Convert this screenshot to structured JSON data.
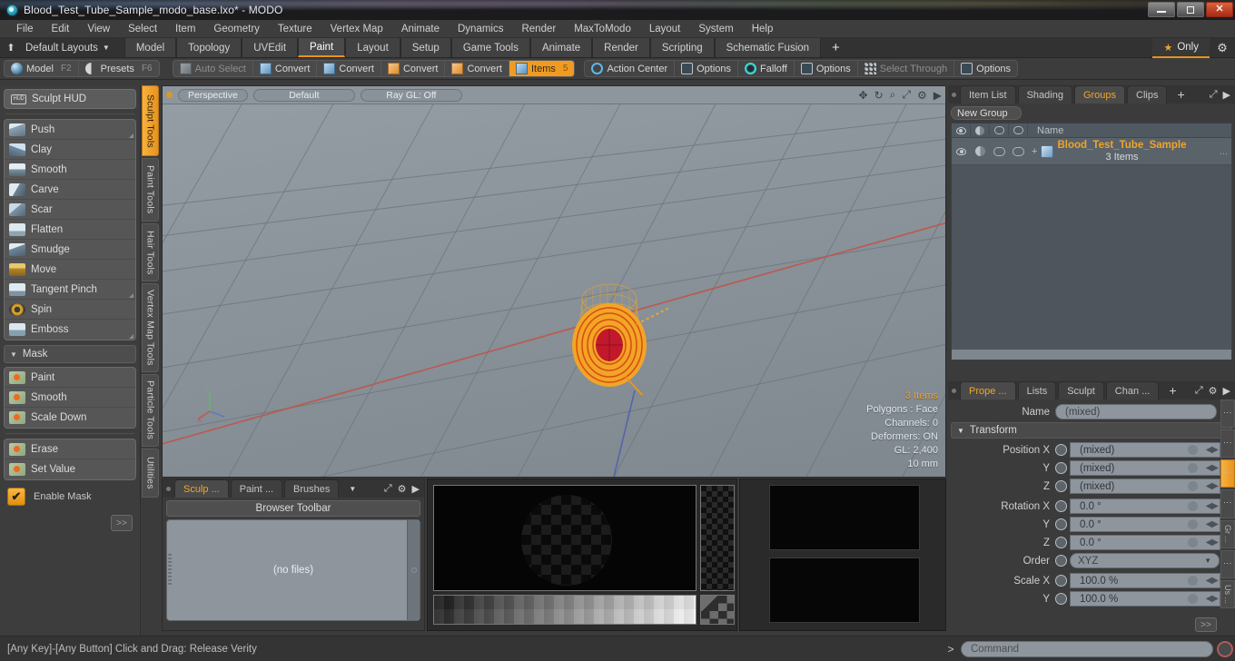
{
  "window": {
    "title": "Blood_Test_Tube_Sample_modo_base.lxo* - MODO",
    "app_icon": "modo-logo-icon",
    "minimize": "minimize-icon",
    "maximize": "restore-icon",
    "close": "close-icon"
  },
  "menubar": {
    "items": [
      "File",
      "Edit",
      "View",
      "Select",
      "Item",
      "Geometry",
      "Texture",
      "Vertex Map",
      "Animate",
      "Dynamics",
      "Render",
      "MaxToModo",
      "Layout",
      "System",
      "Help"
    ]
  },
  "layoutbar": {
    "home_icon": "home-up-icon",
    "layouts_label": "Default Layouts",
    "tabs": [
      {
        "label": "Model",
        "active": false
      },
      {
        "label": "Topology",
        "active": false
      },
      {
        "label": "UVEdit",
        "active": false
      },
      {
        "label": "Paint",
        "active": true
      },
      {
        "label": "Layout",
        "active": false
      },
      {
        "label": "Setup",
        "active": false
      },
      {
        "label": "Game Tools",
        "active": false
      },
      {
        "label": "Animate",
        "active": false
      },
      {
        "label": "Render",
        "active": false
      },
      {
        "label": "Scripting",
        "active": false
      },
      {
        "label": "Schematic Fusion",
        "active": false
      }
    ],
    "add_tab": "+",
    "only_label": "Only",
    "only_icon": "star-icon",
    "settings_icon": "gear-icon"
  },
  "modebar": {
    "left_group": [
      {
        "label": "Model",
        "hotkey": "F2",
        "icon": "sphere-icon",
        "active": false
      },
      {
        "label": "Presets",
        "hotkey": "F6",
        "icon": "half-sphere-icon",
        "active": false
      }
    ],
    "right_group": [
      {
        "label": "Auto Select",
        "icon": "cube-gray-icon",
        "active": false,
        "dim": true
      },
      {
        "label": "Convert",
        "icon": "cube-blue-icon",
        "active": false,
        "dim": false
      },
      {
        "label": "Convert",
        "icon": "cube-blue-icon",
        "active": false,
        "dim": false
      },
      {
        "label": "Convert",
        "icon": "cube-orange-icon",
        "active": false,
        "dim": false
      },
      {
        "label": "Convert",
        "icon": "cube-orange-icon",
        "active": false,
        "dim": false
      },
      {
        "label": "Items",
        "hotkey": "5",
        "icon": "cube-blue-icon",
        "active": true,
        "dim": false
      }
    ],
    "far_group": [
      {
        "label": "Action Center",
        "icon": "target-icon",
        "dim": false
      },
      {
        "label": "Options",
        "icon": "box-icon",
        "dim": false
      },
      {
        "label": "Falloff",
        "icon": "ring-icon",
        "dim": false
      },
      {
        "label": "Options",
        "icon": "box-icon",
        "dim": false
      },
      {
        "label": "Select Through",
        "icon": "dots-icon",
        "dim": true
      },
      {
        "label": "Options",
        "icon": "box-icon",
        "dim": false
      }
    ]
  },
  "left_panel": {
    "hud_label": "Sculpt HUD",
    "hud_icon": "hud-icon",
    "sculpt_tools": [
      {
        "label": "Push",
        "icon": "push-tool-icon",
        "corner": true
      },
      {
        "label": "Clay",
        "icon": "clay-tool-icon",
        "corner": false
      },
      {
        "label": "Smooth",
        "icon": "smooth-tool-icon",
        "corner": false
      },
      {
        "label": "Carve",
        "icon": "carve-tool-icon",
        "corner": false
      },
      {
        "label": "Scar",
        "icon": "scar-tool-icon",
        "corner": false
      },
      {
        "label": "Flatten",
        "icon": "flatten-tool-icon",
        "corner": false
      },
      {
        "label": "Smudge",
        "icon": "smudge-tool-icon",
        "corner": false
      },
      {
        "label": "Move",
        "icon": "move-tool-icon",
        "corner": false
      },
      {
        "label": "Tangent Pinch",
        "icon": "tangent-pinch-tool-icon",
        "corner": true
      },
      {
        "label": "Spin",
        "icon": "spin-tool-icon",
        "corner": false
      },
      {
        "label": "Emboss",
        "icon": "emboss-tool-icon",
        "corner": true
      }
    ],
    "mask_section_label": "Mask",
    "mask_tools": [
      {
        "label": "Paint",
        "icon": "mask-paint-icon"
      },
      {
        "label": "Smooth",
        "icon": "mask-smooth-icon"
      },
      {
        "label": "Scale Down",
        "icon": "mask-scale-down-icon"
      }
    ],
    "mask_tools2": [
      {
        "label": "Erase",
        "icon": "mask-erase-icon"
      },
      {
        "label": "Set Value",
        "icon": "mask-set-value-icon"
      }
    ],
    "enable_mask_label": "Enable Mask",
    "enable_mask_checked": true,
    "advanced_label": ">>"
  },
  "vertical_tabs": [
    {
      "label": "Sculpt Tools",
      "active": true
    },
    {
      "label": "Paint Tools",
      "active": false
    },
    {
      "label": "Hair Tools",
      "active": false
    },
    {
      "label": "Vertex Map Tools",
      "active": false
    },
    {
      "label": "Particle Tools",
      "active": false
    },
    {
      "label": "Utilities",
      "active": false
    }
  ],
  "viewport": {
    "indicator_icon": "viewport-active-dot",
    "pills": [
      "Perspective",
      "Default",
      "Ray GL: Off"
    ],
    "icons": [
      "pan-icon",
      "rotate-icon",
      "zoom-icon",
      "maximize-icon",
      "gear-icon",
      "chevron-right-icon"
    ],
    "info": {
      "items": "3 Items",
      "polygons": "Polygons : Face",
      "channels": "Channels: 0",
      "deformers": "Deformers: ON",
      "gl": "GL: 2,400",
      "scale": "10 mm"
    },
    "model_name": "blood-test-tube-wireframe"
  },
  "browser_panel": {
    "tabs": [
      {
        "label": "Sculp ...",
        "active": true
      },
      {
        "label": "Paint ...",
        "active": false
      },
      {
        "label": "Brushes",
        "active": false
      }
    ],
    "dropdown_icon": "chevron-down-icon",
    "right_icons": [
      "expand-icon",
      "gear-icon",
      "chevron-right-icon"
    ],
    "toolbar_label": "Browser Toolbar",
    "empty_label": "(no files)"
  },
  "image_panels": {
    "preview_name": "brush-alpha-preview",
    "gradient_name": "grayscale-gradient-ramp",
    "black_panel_name": "empty-preview-panel"
  },
  "right_panel": {
    "tabs": [
      {
        "label": "Item List",
        "active": false
      },
      {
        "label": "Shading",
        "active": false
      },
      {
        "label": "Groups",
        "active": true
      },
      {
        "label": "Clips",
        "active": false
      }
    ],
    "add_tab": "+",
    "right_icons": [
      "expand-icon",
      "chevron-right-icon"
    ],
    "new_group_label": "New Group",
    "tree_columns": [
      "visible-eye-icon",
      "shading-icon",
      "render-cap-icon",
      "select-cap-icon",
      "Name"
    ],
    "tree_name_header": "Name",
    "rows": [
      {
        "name": "Blood_Test_Tube_Sample",
        "sub": "3 Items",
        "icon": "mesh-group-icon",
        "expander": "+",
        "ellipsis": "..."
      }
    ]
  },
  "properties_panel": {
    "tabs": [
      {
        "label": "Prope ...",
        "active": true
      },
      {
        "label": "Lists",
        "active": false
      },
      {
        "label": "Sculpt",
        "active": false
      },
      {
        "label": "Chan ...",
        "active": false
      }
    ],
    "add_tab": "+",
    "right_icons": [
      "expand-icon",
      "gear-icon",
      "chevron-right-icon"
    ],
    "name_label": "Name",
    "name_value": "(mixed)",
    "transform_label": "Transform",
    "fields": [
      {
        "label": "Position X",
        "value": "(mixed)",
        "type": "value"
      },
      {
        "label": "Y",
        "value": "(mixed)",
        "type": "value"
      },
      {
        "label": "Z",
        "value": "(mixed)",
        "type": "value"
      },
      {
        "label": "Rotation X",
        "value": "0.0 °",
        "type": "value"
      },
      {
        "label": "Y",
        "value": "0.0 °",
        "type": "value"
      },
      {
        "label": "Z",
        "value": "0.0 °",
        "type": "value"
      },
      {
        "label": "Order",
        "value": "XYZ",
        "type": "dropdown"
      },
      {
        "label": "Scale X",
        "value": "100.0 %",
        "type": "value"
      },
      {
        "label": "Y",
        "value": "100.0 %",
        "type": "value"
      }
    ],
    "side_tabs": [
      {
        "label": "",
        "active": false
      },
      {
        "label": "",
        "active": false
      },
      {
        "label": "",
        "active": true
      },
      {
        "label": "",
        "active": false
      },
      {
        "label": "Gr ...",
        "active": false
      },
      {
        "label": "",
        "active": false
      },
      {
        "label": "",
        "active": false
      },
      {
        "label": "Us ...",
        "active": false
      }
    ],
    "advanced_label": ">>"
  },
  "statusbar": {
    "hint": "[Any Key]-[Any Button] Click and Drag:   Release Verity",
    "command_arrow": ">",
    "command_placeholder": "Command",
    "record_icon": "record-icon"
  },
  "colors": {
    "accent_orange": "#f0a52a",
    "panel_bg": "#3b3b3b",
    "viewport_bg": "#8b939b",
    "field_bg": "#8e959c"
  }
}
